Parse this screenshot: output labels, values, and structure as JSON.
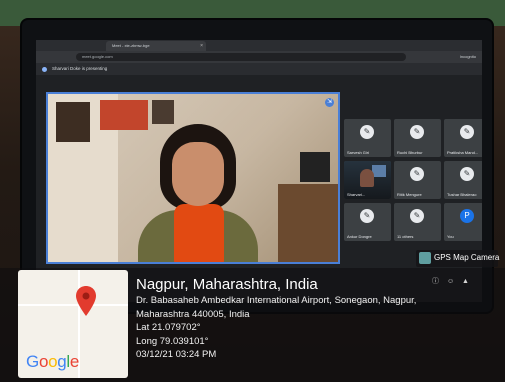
{
  "browser": {
    "tab_title": "Meet - xte-zbmw-bge",
    "url": "meet.google.com",
    "profile": "Incognito"
  },
  "meeting": {
    "presenting_banner": "Sharvari Doke is presenting"
  },
  "participants": [
    {
      "name": "Sarvesh Giri",
      "avatar": "mic-off-icon"
    },
    {
      "name": "Ruchi Bhurbur",
      "avatar": "mic-off-icon"
    },
    {
      "name": "Pratiksha Mand...",
      "avatar": "mic-off-icon"
    },
    {
      "name": "Sharvari...",
      "avatar": "video"
    },
    {
      "name": "Ritik Mengure",
      "avatar": "mic-off-icon"
    },
    {
      "name": "Tushar Bhalerao",
      "avatar": "mic-off-icon"
    },
    {
      "name": "Ankur Dongre",
      "avatar": "mic-off-icon"
    },
    {
      "name": "11 others",
      "avatar": "mic-off-icon"
    },
    {
      "name": "You",
      "avatar": "P"
    }
  ],
  "gps": {
    "brand": "GPS Map Camera",
    "map_logo": "Google",
    "location_title": "Nagpur, Maharashtra, India",
    "address_line1": "Dr. Babasaheb Ambedkar International Airport, Sonegaon, Nagpur,",
    "address_line2": "Maharashtra 440005, India",
    "lat": "Lat 21.079702°",
    "long": "Long 79.039101°",
    "datetime": "03/12/21 03:24 PM"
  },
  "colors": {
    "accent_border": "#4a7fd6",
    "pin_red": "#e23b2e",
    "scarf": "#e24a12"
  }
}
